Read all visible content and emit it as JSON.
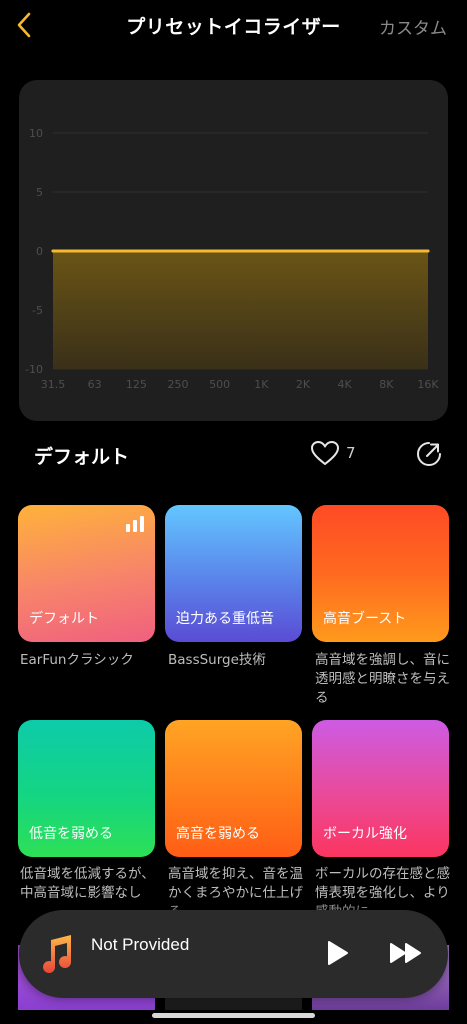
{
  "nav": {
    "title": "プリセットイコライザー",
    "custom": "カスタム"
  },
  "colors": {
    "accent": "#f5b82e",
    "card": "#1f1f1f",
    "muted": "#8a8a8a"
  },
  "equalizer": {
    "y_ticks": [
      "10",
      "5",
      "0",
      "-5",
      "-10"
    ],
    "x_ticks": [
      "31.5",
      "63",
      "125",
      "250",
      "500",
      "1K",
      "2K",
      "4K",
      "8K",
      "16K"
    ],
    "gains_db": [
      0,
      0,
      0,
      0,
      0,
      0,
      0,
      0,
      0,
      0
    ],
    "ylim": [
      -10,
      10
    ]
  },
  "current": {
    "name": "デフォルト",
    "likes": "7"
  },
  "presets": [
    {
      "label": "デフォルト",
      "desc": "EarFunクラシック",
      "active": true
    },
    {
      "label": "迫力ある重低音",
      "desc": "BassSurge技術",
      "active": false
    },
    {
      "label": "高音ブースト",
      "desc": "高音域を強調し、音に透明感と明瞭さを与える",
      "active": false
    },
    {
      "label": "低音を弱める",
      "desc": "低音域を低減するが、中高音域に影響なし",
      "active": false
    },
    {
      "label": "高音を弱める",
      "desc": "高音域を抑え、音を温かくまろやかに仕上げる",
      "active": false
    },
    {
      "label": "ボーカル強化",
      "desc": "ボーカルの存在感と感情表現を強化し、より感動的に",
      "active": false
    }
  ],
  "player": {
    "title": "Not Provided",
    "icon": "music-note-icon"
  }
}
